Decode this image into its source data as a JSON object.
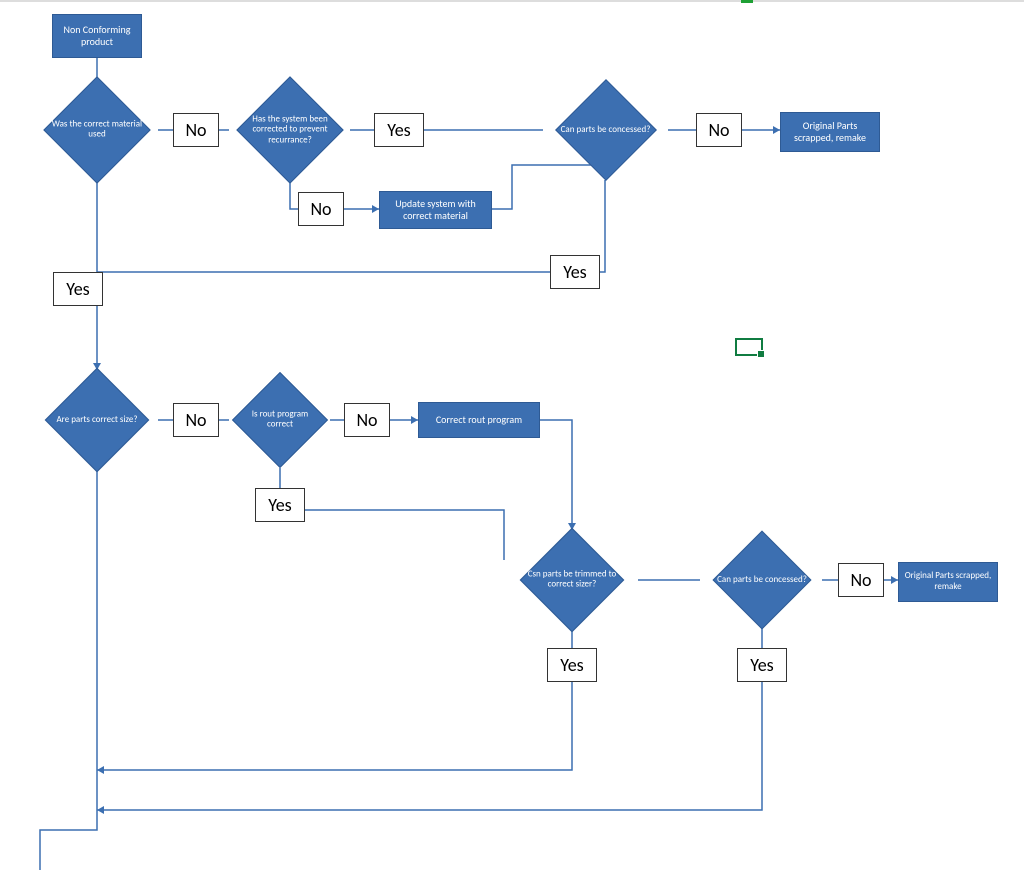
{
  "nodes": {
    "start": "Non Conforming product",
    "d_material": "Was the correct material used",
    "d_system": "Has the system been corrected to prevent recurrance?",
    "d_concess1": "Can parts be concessed?",
    "p_scrap1": "Original Parts scrapped, remake",
    "p_update": "Update system with correct material",
    "d_size": "Are parts correct size?",
    "d_rout": "Is rout program correct",
    "p_corrrout": "Correct rout program",
    "d_trim": "Csn parts be trimmed to correct sizer?",
    "d_concess2": "Can parts be concessed?",
    "p_scrap2": "Original Parts scrapped, remake"
  },
  "labels": {
    "no": "No",
    "yes": "Yes"
  },
  "chart_data": {
    "type": "flowchart",
    "nodes": [
      {
        "id": "start",
        "kind": "process",
        "text": "Non Conforming product"
      },
      {
        "id": "d_material",
        "kind": "decision",
        "text": "Was the correct material used"
      },
      {
        "id": "d_system",
        "kind": "decision",
        "text": "Has the system been corrected to prevent recurrance?"
      },
      {
        "id": "d_concess1",
        "kind": "decision",
        "text": "Can parts be concessed?"
      },
      {
        "id": "p_scrap1",
        "kind": "process",
        "text": "Original Parts scrapped, remake"
      },
      {
        "id": "p_update",
        "kind": "process",
        "text": "Update system with correct material"
      },
      {
        "id": "d_size",
        "kind": "decision",
        "text": "Are parts correct size?"
      },
      {
        "id": "d_rout",
        "kind": "decision",
        "text": "Is rout program correct"
      },
      {
        "id": "p_corrrout",
        "kind": "process",
        "text": "Correct rout program"
      },
      {
        "id": "d_trim",
        "kind": "decision",
        "text": "Csn parts be trimmed to correct sizer?"
      },
      {
        "id": "d_concess2",
        "kind": "decision",
        "text": "Can parts be concessed?"
      },
      {
        "id": "p_scrap2",
        "kind": "process",
        "text": "Original Parts scrapped, remake"
      }
    ],
    "edges": [
      {
        "from": "start",
        "to": "d_material"
      },
      {
        "from": "d_material",
        "to": "d_system",
        "label": "No"
      },
      {
        "from": "d_material",
        "to": "d_size",
        "label": "Yes"
      },
      {
        "from": "d_system",
        "to": "d_concess1",
        "label": "Yes"
      },
      {
        "from": "d_system",
        "to": "p_update",
        "label": "No"
      },
      {
        "from": "p_update",
        "to": "d_concess1"
      },
      {
        "from": "d_concess1",
        "to": "p_scrap1",
        "label": "No"
      },
      {
        "from": "d_concess1",
        "to": "d_size",
        "label": "Yes"
      },
      {
        "from": "d_size",
        "to": "d_rout",
        "label": "No"
      },
      {
        "from": "d_rout",
        "to": "p_corrrout",
        "label": "No"
      },
      {
        "from": "d_rout",
        "to": "d_trim",
        "label": "Yes"
      },
      {
        "from": "p_corrrout",
        "to": "d_trim"
      },
      {
        "from": "d_trim",
        "to": "d_size",
        "label": "Yes",
        "note": "loop back"
      },
      {
        "from": "d_trim",
        "to": "d_concess2"
      },
      {
        "from": "d_concess2",
        "to": "p_scrap2",
        "label": "No"
      },
      {
        "from": "d_concess2",
        "to": "d_size",
        "label": "Yes",
        "note": "loop back"
      },
      {
        "from": "d_size",
        "to": "continue",
        "label": "Yes",
        "note": "exit down-left"
      }
    ]
  }
}
